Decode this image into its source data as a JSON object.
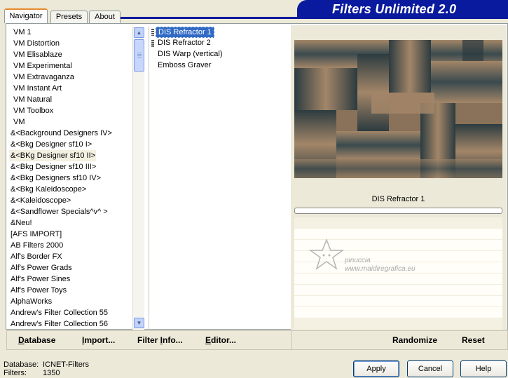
{
  "title": "Filters Unlimited 2.0",
  "tabs": [
    "Navigator",
    "Presets",
    "About"
  ],
  "categories": [
    "VM 1",
    "VM Distortion",
    "VM Elisablaze",
    "VM Experimental",
    "VM Extravaganza",
    "VM Instant Art",
    "VM Natural",
    "VM Toolbox",
    "VM",
    "&<Background Designers IV>",
    "&<Bkg Designer sf10 I>",
    "&<BKg Designer sf10 II>",
    "&<Bkg Designer sf10 III>",
    "&<Bkg Designers sf10 IV>",
    "&<Bkg Kaleidoscope>",
    "&<Kaleidoscope>",
    "&<Sandflower Specials^v^ >",
    "&Neu!",
    "[AFS IMPORT]",
    "AB Filters 2000",
    "Alf's Border FX",
    "Alf's Power Grads",
    "Alf's Power Sines",
    "Alf's Power Toys",
    "AlphaWorks",
    "Andrew's Filter Collection 55",
    "Andrew's Filter Collection 56"
  ],
  "selected_category": "&<BKg Designer sf10 II>",
  "filters": [
    "DIS Refractor 1",
    "DIS Refractor 2",
    "DIS Warp (vertical)",
    "Emboss Graver"
  ],
  "selected_filter": "DIS Refractor 1",
  "preview": {
    "filter_name": "DIS Refractor 1",
    "progress_fraction": 0.0
  },
  "watermark": {
    "line1": "pinuccia",
    "line2": "www.maidiregrafica.eu"
  },
  "toolbar": {
    "database": {
      "u": "D",
      "rest": "atabase"
    },
    "import": {
      "u": "I",
      "rest": "mport..."
    },
    "filter_info": {
      "pre": "Filter ",
      "u": "I",
      "rest": "nfo..."
    },
    "editor": {
      "u": "E",
      "rest": "ditor..."
    },
    "randomize": "Randomize",
    "reset": "Reset"
  },
  "status": {
    "database_label": "Database:",
    "database_value": "ICNET-Filters",
    "filters_label": "Filters:",
    "filters_value": "1350"
  },
  "buttons": {
    "apply": "Apply",
    "cancel": "Cancel",
    "help": "Help"
  },
  "colors": {
    "banner": "#0a1a9e",
    "selection": "#316ac5",
    "preview_tan": "#9a7e63",
    "preview_dark": "#2c3b40"
  }
}
